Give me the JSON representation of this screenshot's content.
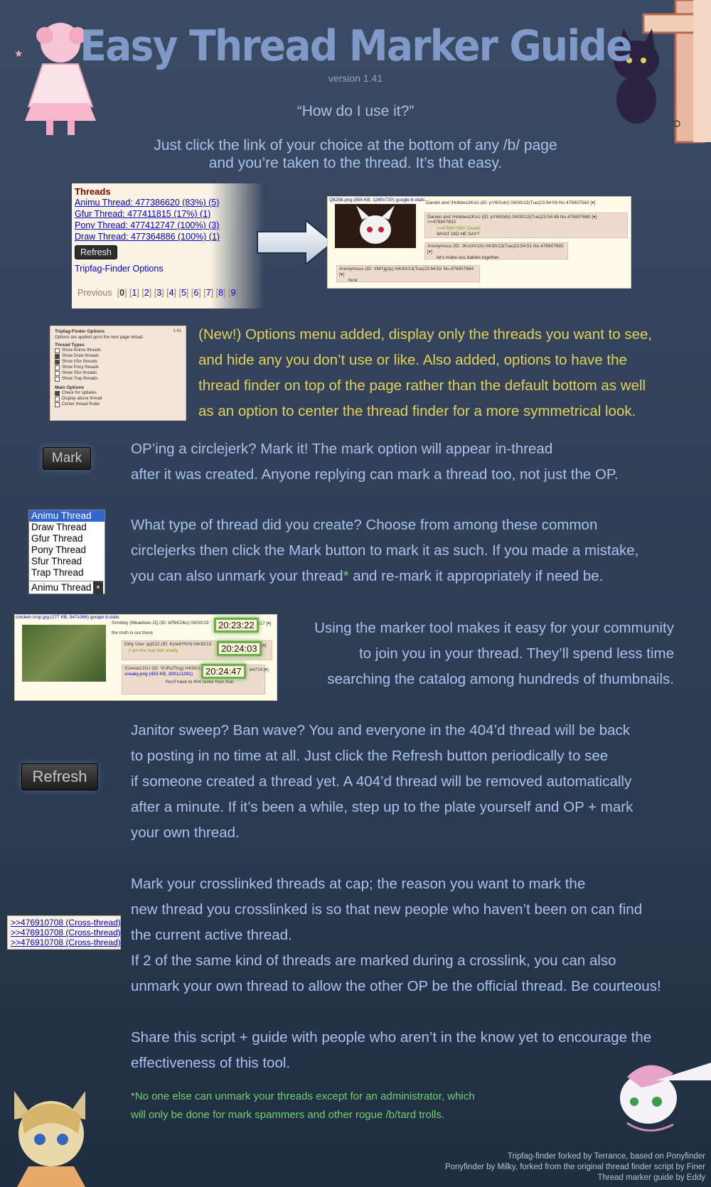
{
  "header": {
    "title": "Easy Thread Marker Guide",
    "version": "version 1.41",
    "question": "“How do I use it?”",
    "intro_line1": "Just click the link of your choice at the bottom of any /b/ page",
    "intro_line2": "and you’re taken to the thread. It’s that easy."
  },
  "threads_panel": {
    "heading": "Threads",
    "links": [
      "Animu Thread: 477386620 (83%) (5)",
      "Gfur Thread: 477411815 (17%) (1)",
      "Pony Thread: 477412747 (100%) (3)",
      "Draw Thread: 477364886 (100%) (1)"
    ],
    "refresh_label": "Refresh",
    "options_link": "Tripfag-Finder Options",
    "pager_prev": "Previous",
    "pager_current": "0",
    "pager_pages": [
      "1",
      "2",
      "3",
      "4",
      "5",
      "6",
      "7",
      "8",
      "9"
    ]
  },
  "thread_shot": {
    "file": "Q8258.png (856 KB, 1280x720) google b-stats",
    "post1": "Darwin and !Hobbes2KsU (ID: pY6tXxb/) 04/30/13(Tue)23:54:09 No.476907563 [▾]",
    "post2": "Darwin and !Hobbes2KsU (ID: pY6tXxb/) 04/30/13(Tue)23:54:48 No.476907680 [▾] >>476907832",
    "post2_quote": ">>476907380 (Dead)",
    "post2_text": "WHAT DID HE SAY?",
    "post3": "Anonymous (ID: JK/oXV10) 04/30/13(Tue)23:54:51 No.476907692 [▾]",
    "post3_text": "let's make ass babies together",
    "post4": "Anonymous (ID: XMYjg2p) 04/30/13(Tue)23:54:52 No.476907694 [▾]",
    "post4_text": "forst"
  },
  "options_panel": {
    "title": "Tripfag-Finder Options",
    "version": "1.41",
    "note": "Options are applied upon the next page reload.",
    "types_heading": "Thread Types",
    "types": [
      {
        "label": "Show Animu threads",
        "checked": false
      },
      {
        "label": "Show Draw threads",
        "checked": true
      },
      {
        "label": "Show Gfur threads",
        "checked": true
      },
      {
        "label": "Show Pony threads",
        "checked": false
      },
      {
        "label": "Show Sfur threads",
        "checked": false
      },
      {
        "label": "Show Trap threads",
        "checked": false
      }
    ],
    "main_heading": "Main Options",
    "main": [
      {
        "label": "Check for updates",
        "checked": true
      },
      {
        "label": "Display above thread",
        "checked": false
      },
      {
        "label": "Center thread finder",
        "checked": false
      }
    ]
  },
  "sections": {
    "new_options": [
      "(New!) Options menu added, display only the threads you want to see,",
      "and hide any you don’t use or like. Also added, options to have the",
      "thread finder on top of the page rather than the default bottom as well",
      "as an option to center the thread finder for a more symmetrical look."
    ],
    "mark_label": "Mark",
    "mark_text": [
      "OP’ing a circlejerk? Mark it! The mark option will appear in-thread",
      "after it was created. Anyone replying can mark a thread too, not just the OP."
    ],
    "thread_types": [
      "Animu Thread",
      "Draw Thread",
      "Gfur Thread",
      "Pony Thread",
      "Sfur Thread",
      "Trap Thread"
    ],
    "select_current": "Animu Thread",
    "type_text_1": "What type of thread did you create? Choose from among these common",
    "type_text_2": "circlejerks then click the Mark button to mark it as such. If you made a mistake,",
    "type_text_3a": "you can also unmark your thread",
    "type_text_star": "*",
    "type_text_3b": " and re-mark it appropriately if need be.",
    "marker_text": [
      "Using the marker tool makes it easy for your community",
      "to join you in your thread. They’ll spend less time",
      "searching the catalog among hundreds of thumbnails."
    ],
    "refresh_label": "Refresh",
    "refresh_text": [
      "Janitor sweep? Ban wave? You and everyone in the 404’d thread will be back",
      "to posting in no time at all. Just click the Refresh button periodically to see",
      "if someone created a thread yet. A 404’d thread will be removed automatically",
      "after a minute. If it’s been a while, step up to the plate yourself and OP + mark",
      "your own thread."
    ],
    "cross_links": [
      ">>476910708 (Cross-thread)",
      ">>476910708 (Cross-thread)",
      ">>476910708 (Cross-thread)"
    ],
    "cross_text": [
      "Mark your crosslinked threads at cap; the reason you want to mark the",
      "new thread you crosslinked is so that new people who haven’t been on can find",
      "the current active thread.",
      "If 2 of the same kind of threads are marked during a crosslink, you can also",
      "unmark your own thread to allow the other OP be the official thread. Be courteous!"
    ],
    "share_text": [
      "Share this script + guide with people who aren’t in the know yet to encourage the",
      "effectiveness of this tool."
    ],
    "footnote": [
      "*No one else can unmark your threads except for an administrator, which",
      "will only be done for mark spammers and other rogue /b/tard trolls."
    ]
  },
  "time_shot": {
    "file": "chicken crop.jpg (277 KB, 547x366) google b-stats",
    "p1": "Smokey (Meadows.JQ (ID: kPBK2ikc) 04/30/13",
    "p1_no": "864417 [▾]",
    "p1_text": "the truth is out there",
    "p2": "Dirty Uoe: qqS22 (ID: Kzie9YKH) 04/30/13",
    "p2_no": "560 [▾]",
    "p2_text": ":I am the real slim shady",
    "p3": "!Cereal121U (ID: VURaTbrg) 04/30/13",
    "p3_no": "64724 [▾]",
    "p3_file": "sneaky.png (453 KB, 3001x1281)",
    "p3_text": "You'll have to 404 faster than that.",
    "times": [
      "20:23:22",
      "20:24:03",
      "20:24:47"
    ]
  },
  "credits": [
    "Tripfag-finder forked by Terrance, based on Ponyfinder",
    "Ponyfinder by Milky, forked from the original thread finder script by Finer",
    "Thread marker guide by Eddy"
  ],
  "colors": {
    "background": "#33425a",
    "title": "#7f99c8",
    "text": "#a9c1ec",
    "highlight_yellow": "#e0d25a",
    "highlight_green": "#6fd16f"
  }
}
